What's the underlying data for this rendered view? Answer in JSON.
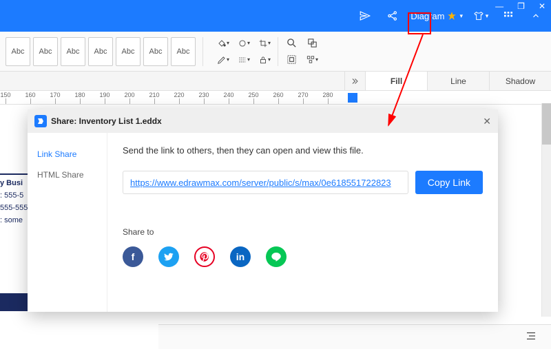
{
  "titlebar": {
    "diagram_label": "Diagram"
  },
  "ribbon": {
    "abc_labels": [
      "Abc",
      "Abc",
      "Abc",
      "Abc",
      "Abc",
      "Abc",
      "Abc"
    ]
  },
  "ruler": {
    "ticks": [
      150,
      160,
      170,
      180,
      190,
      200,
      210,
      220,
      230,
      240,
      250,
      260,
      270,
      280
    ]
  },
  "panel_tabs": {
    "fill": "Fill",
    "line": "Line",
    "shadow": "Shadow"
  },
  "doc_strip": {
    "title": "y Busi",
    "phone1": ": 555-5",
    "phone2": "555-555",
    "email": ": some"
  },
  "share_dialog": {
    "title": "Share: Inventory List 1.eddx",
    "side": {
      "link_share": "Link Share",
      "html_share": "HTML Share"
    },
    "description": "Send the link to others, then they can open and view this file.",
    "link_url": "https://www.edrawmax.com/server/public/s/max/0e618551722823",
    "copy_button": "Copy Link",
    "share_to_label": "Share to",
    "social": {
      "facebook": "f",
      "twitter": "t",
      "pinterest": "p",
      "linkedin": "in",
      "line": "L"
    }
  }
}
